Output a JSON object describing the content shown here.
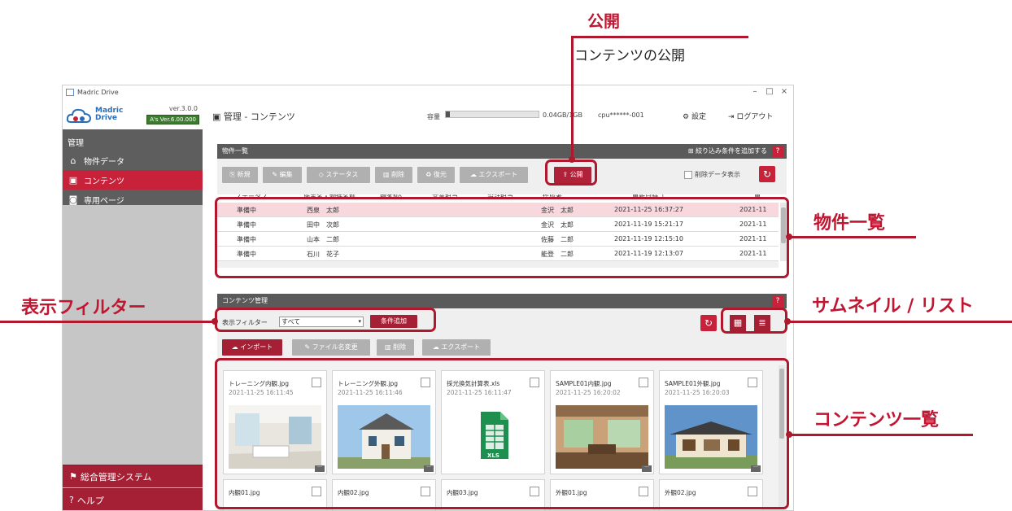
{
  "window": {
    "title": "Madric Drive",
    "controls": [
      "–",
      "□",
      "×"
    ]
  },
  "logo": {
    "name_line1": "Madric",
    "name_line2": "Drive",
    "version": "ver.3.0.0",
    "as_version": "A's Ver.6.00.000"
  },
  "sidebar": {
    "section": "管理",
    "items": [
      {
        "label": "物件データ",
        "icon": "home-icon"
      },
      {
        "label": "コンテンツ",
        "icon": "image-icon",
        "active": true
      },
      {
        "label": "専用ページ",
        "icon": "page-icon"
      }
    ],
    "bottom": [
      {
        "label": "総合管理システム",
        "icon": "admin-icon"
      },
      {
        "label": "ヘルプ",
        "icon": "help-icon"
      }
    ]
  },
  "header": {
    "page_title": "管理 - コンテンツ",
    "capacity_label": "容量",
    "capacity_fraction": 0.04,
    "capacity_text": "0.04GB/1GB",
    "cpu": "cpu******-001",
    "settings": "設定",
    "logout": "ログアウト"
  },
  "property_panel": {
    "title": "物件一覧",
    "add_filter": "絞り込み条件を追加する",
    "help": "?",
    "toolbar": [
      "新規",
      "編集",
      "ステータス",
      "削除",
      "復元",
      "エクスポート",
      "公開"
    ],
    "show_deleted": "削除データ表示",
    "columns": [
      "ステータス",
      "施主名・物件名称",
      "顧客No",
      "営業担当",
      "設計担当",
      "作成者",
      "更新日時 ↓",
      "更"
    ],
    "rows": [
      {
        "status": "準備中",
        "owner": "西泉　太郎",
        "creator": "金沢　太郎",
        "updated": "2021-11-25 16:37:27",
        "extra": "2021-11"
      },
      {
        "status": "準備中",
        "owner": "田中　次郎",
        "creator": "金沢　太郎",
        "updated": "2021-11-19 15:21:17",
        "extra": "2021-11"
      },
      {
        "status": "準備中",
        "owner": "山本　二郎",
        "creator": "佐藤　二郎",
        "updated": "2021-11-19 12:15:10",
        "extra": "2021-11"
      },
      {
        "status": "準備中",
        "owner": "石川　花子",
        "creator": "能登　二郎",
        "updated": "2021-11-19 12:13:07",
        "extra": "2021-11"
      }
    ]
  },
  "contents_panel": {
    "title": "コンテンツ管理",
    "help": "?",
    "filter_label": "表示フィルター",
    "filter_value": "すべて",
    "condition_button": "条件追加",
    "toolbar": [
      "インポート",
      "ファイル名変更",
      "削除",
      "エクスポート"
    ],
    "cards": [
      {
        "name": "トレーニング内観.jpg",
        "date": "2021-11-25 16:11:45",
        "kind": "interior"
      },
      {
        "name": "トレーニング外観.jpg",
        "date": "2021-11-25 16:11:46",
        "kind": "exterior"
      },
      {
        "name": "採光換気計算表.xls",
        "date": "2021-11-25 16:11:47",
        "kind": "xls"
      },
      {
        "name": "SAMPLE01内観.jpg",
        "date": "2021-11-25 16:20:02",
        "kind": "interior2"
      },
      {
        "name": "SAMPLE01外観.jpg",
        "date": "2021-11-25 16:20:03",
        "kind": "exterior2"
      }
    ],
    "cards_row2": [
      {
        "name": "内観01.jpg"
      },
      {
        "name": "内観02.jpg"
      },
      {
        "name": "内観03.jpg"
      },
      {
        "name": "外観01.jpg"
      },
      {
        "name": "外観02.jpg"
      }
    ],
    "xls_label": "XLS"
  },
  "annotations": {
    "publish_title": "公開",
    "publish_sub": "コンテンツの公開",
    "property_list": "物件一覧",
    "display_filter": "表示フィルター",
    "thumb_list": "サムネイル / リスト",
    "content_list": "コンテンツ一覧"
  },
  "colors": {
    "accent": "#c8213a",
    "annotation": "#b0182e",
    "sidebar_dark": "#5e5e5e",
    "sidebar_light": "#c6c6c6"
  }
}
